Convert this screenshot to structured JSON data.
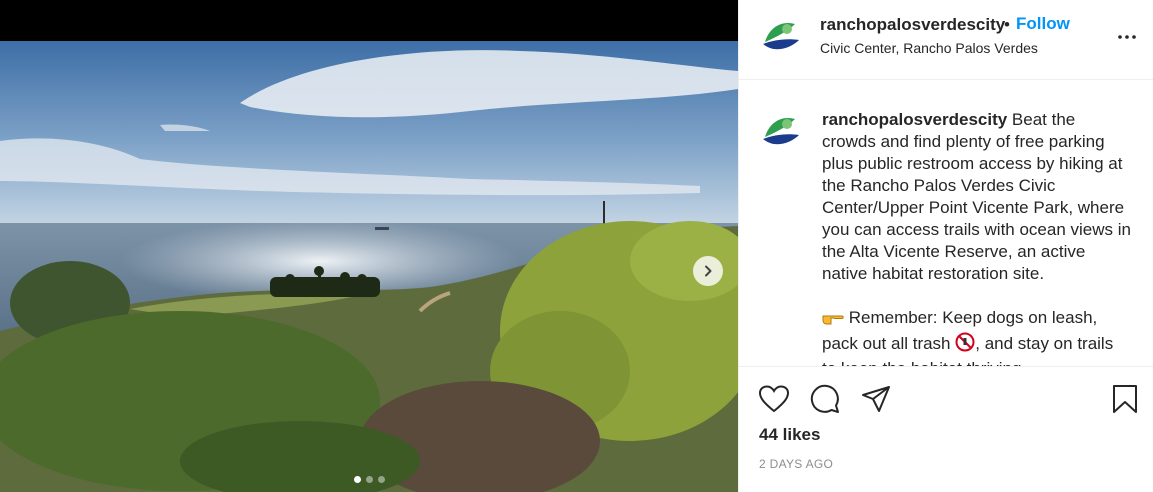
{
  "post": {
    "username": "ranchopalosverdescity",
    "follow_label": "Follow",
    "separator": "•",
    "location": "Civic Center, Rancho Palos Verdes"
  },
  "caption": {
    "username": "ranchopalosverdescity",
    "text1": " Beat the crowds and find plenty of free parking plus public restroom access by hiking at the Rancho Palos Verdes Civic Center/Upper Point Vicente Park, where you can access trails with ocean views in the Alta Vicente Reserve, an active native habitat restoration site.",
    "text2a": " Remember: Keep dogs on leash, pack out all trash ",
    "text2b": ", and stay on trails to keep the habitat thriving."
  },
  "engagement": {
    "likes": "44 likes",
    "timestamp": "2 DAYS AGO"
  },
  "carousel": {
    "slide_count": 3,
    "active_index": 0
  },
  "icons": {
    "more": "more-options-icon",
    "like": "heart-icon",
    "comment": "comment-icon",
    "share": "share-icon",
    "save": "bookmark-icon",
    "next": "chevron-right-icon"
  },
  "colors": {
    "follow": "#0095f6",
    "text": "#262626",
    "muted": "#8e8e8e"
  }
}
